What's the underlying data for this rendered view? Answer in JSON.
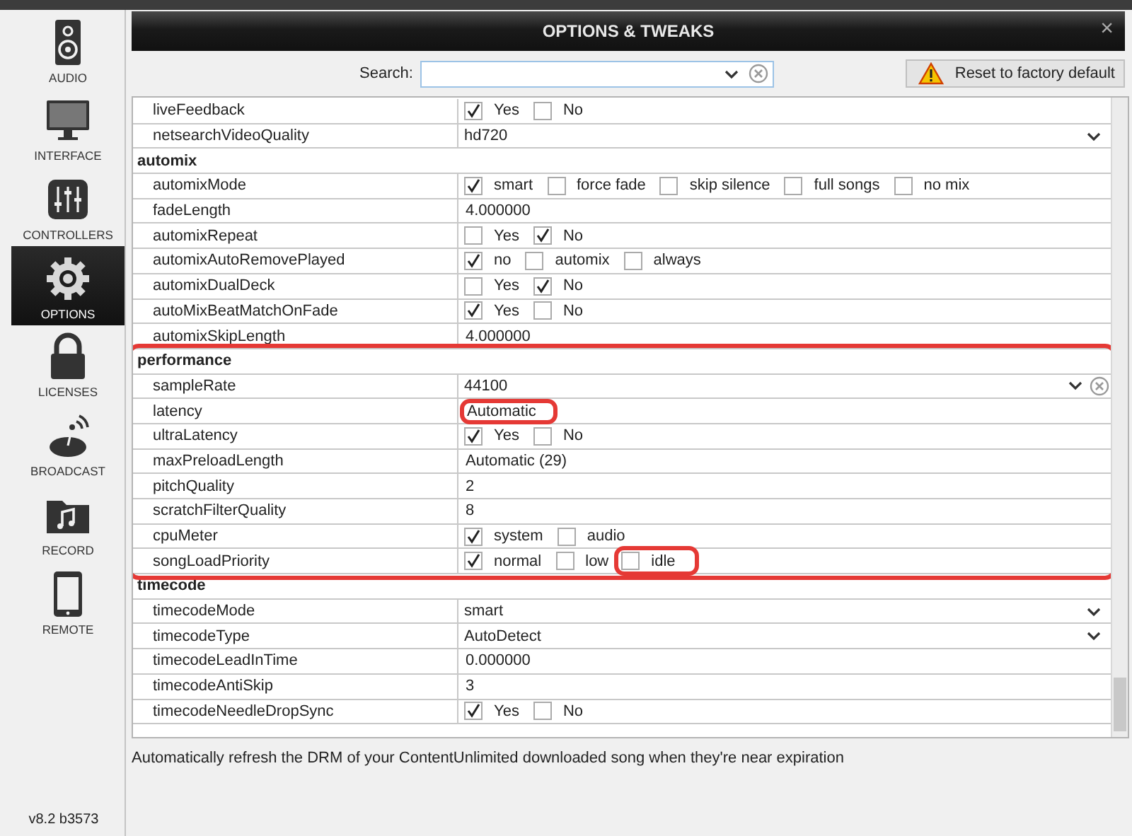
{
  "sidebar": {
    "items": [
      {
        "label": "AUDIO",
        "selected": false
      },
      {
        "label": "INTERFACE",
        "selected": false
      },
      {
        "label": "CONTROLLERS",
        "selected": false
      },
      {
        "label": "OPTIONS",
        "selected": true
      },
      {
        "label": "LICENSES",
        "selected": false
      },
      {
        "label": "BROADCAST",
        "selected": false
      },
      {
        "label": "RECORD",
        "selected": false
      },
      {
        "label": "REMOTE",
        "selected": false
      }
    ],
    "version": "v8.2 b3573"
  },
  "window": {
    "title": "OPTIONS & TWEAKS",
    "close": "×"
  },
  "search": {
    "label": "Search:"
  },
  "reset_button": "Reset to factory default",
  "groups": [
    {
      "annotated": false,
      "rows": [
        {
          "name": "liveFeedback",
          "kind": "options",
          "options": [
            {
              "label": "Yes",
              "checked": true,
              "annotated": false
            },
            {
              "label": "No",
              "checked": false,
              "annotated": false
            }
          ]
        },
        {
          "name": "netsearchVideoQuality",
          "kind": "dropdown",
          "value": "hd720"
        }
      ]
    },
    {
      "title": "automix",
      "annotated": false,
      "rows": [
        {
          "name": "automixMode",
          "kind": "options",
          "options": [
            {
              "label": "smart",
              "checked": true,
              "annotated": false
            },
            {
              "label": "force fade",
              "checked": false,
              "annotated": false
            },
            {
              "label": "skip silence",
              "checked": false,
              "annotated": false
            },
            {
              "label": "full songs",
              "checked": false,
              "annotated": false
            },
            {
              "label": "no mix",
              "checked": false,
              "annotated": false
            }
          ]
        },
        {
          "name": "fadeLength",
          "kind": "text",
          "value": "4.000000",
          "annotated": false
        },
        {
          "name": "automixRepeat",
          "kind": "options",
          "options": [
            {
              "label": "Yes",
              "checked": false,
              "annotated": false
            },
            {
              "label": "No",
              "checked": true,
              "annotated": false
            }
          ]
        },
        {
          "name": "automixAutoRemovePlayed",
          "kind": "options",
          "options": [
            {
              "label": "no",
              "checked": true,
              "annotated": false
            },
            {
              "label": "automix",
              "checked": false,
              "annotated": false
            },
            {
              "label": "always",
              "checked": false,
              "annotated": false
            }
          ]
        },
        {
          "name": "automixDualDeck",
          "kind": "options",
          "options": [
            {
              "label": "Yes",
              "checked": false,
              "annotated": false
            },
            {
              "label": "No",
              "checked": true,
              "annotated": false
            }
          ]
        },
        {
          "name": "autoMixBeatMatchOnFade",
          "kind": "options",
          "options": [
            {
              "label": "Yes",
              "checked": true,
              "annotated": false
            },
            {
              "label": "No",
              "checked": false,
              "annotated": false
            }
          ]
        },
        {
          "name": "automixSkipLength",
          "kind": "text",
          "value": "4.000000",
          "annotated": false
        }
      ]
    },
    {
      "title": "performance",
      "annotated": true,
      "rows": [
        {
          "name": "sampleRate",
          "kind": "combo",
          "value": "44100"
        },
        {
          "name": "latency",
          "kind": "text",
          "value": "Automatic",
          "annotated": true
        },
        {
          "name": "ultraLatency",
          "kind": "options",
          "options": [
            {
              "label": "Yes",
              "checked": true,
              "annotated": false
            },
            {
              "label": "No",
              "checked": false,
              "annotated": false
            }
          ]
        },
        {
          "name": "maxPreloadLength",
          "kind": "text",
          "value": "Automatic (29)",
          "annotated": false
        },
        {
          "name": "pitchQuality",
          "kind": "text",
          "value": "2",
          "annotated": false
        },
        {
          "name": "scratchFilterQuality",
          "kind": "text",
          "value": "8",
          "annotated": false
        },
        {
          "name": "cpuMeter",
          "kind": "options",
          "options": [
            {
              "label": "system",
              "checked": true,
              "annotated": false
            },
            {
              "label": "audio",
              "checked": false,
              "annotated": false
            }
          ]
        },
        {
          "name": "songLoadPriority",
          "kind": "options",
          "options": [
            {
              "label": "normal",
              "checked": true,
              "annotated": false
            },
            {
              "label": "low",
              "checked": false,
              "annotated": false
            },
            {
              "label": "idle",
              "checked": false,
              "annotated": true
            }
          ]
        }
      ]
    },
    {
      "title": "timecode",
      "annotated": false,
      "rows": [
        {
          "name": "timecodeMode",
          "kind": "dropdown",
          "value": "smart"
        },
        {
          "name": "timecodeType",
          "kind": "dropdown",
          "value": "AutoDetect"
        },
        {
          "name": "timecodeLeadInTime",
          "kind": "text",
          "value": "0.000000",
          "annotated": false
        },
        {
          "name": "timecodeAntiSkip",
          "kind": "text",
          "value": "3",
          "annotated": false
        },
        {
          "name": "timecodeNeedleDropSync",
          "kind": "options",
          "options": [
            {
              "label": "Yes",
              "checked": true,
              "annotated": false
            },
            {
              "label": "No",
              "checked": false,
              "annotated": false
            }
          ]
        }
      ]
    }
  ],
  "description": "Automatically refresh the DRM of your ContentUnlimited downloaded song when they're near expiration"
}
